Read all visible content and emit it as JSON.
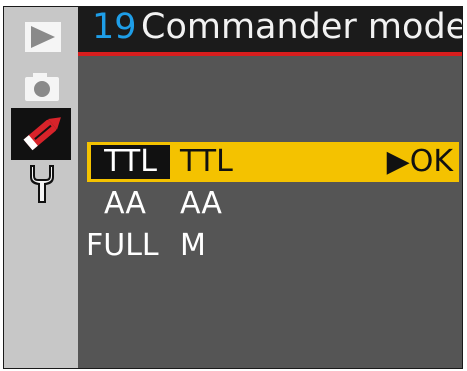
{
  "header": {
    "number": "19",
    "title": "Commander mode"
  },
  "sidebar": {
    "tabs": [
      {
        "icon": "playback-icon",
        "selected": false
      },
      {
        "icon": "camera-icon",
        "selected": false
      },
      {
        "icon": "pencil-icon",
        "selected": true
      },
      {
        "icon": "wrench-icon",
        "selected": false
      }
    ]
  },
  "rows": [
    {
      "label": "TTL",
      "value": "TTL",
      "action": "▶OK",
      "selected": true
    },
    {
      "label": "AA",
      "value": "AA",
      "selected": false
    },
    {
      "label": "FULL",
      "value": "M",
      "selected": false
    }
  ],
  "colors": {
    "accent_blue": "#1e9ee8",
    "header_rule": "#d81e1e",
    "selection": "#f4c200",
    "edit_red": "#d8232a"
  }
}
